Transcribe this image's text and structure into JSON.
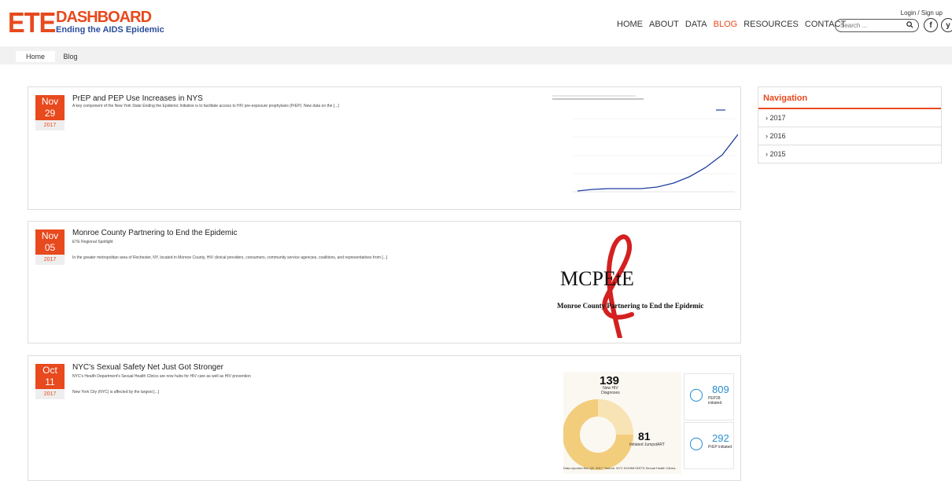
{
  "header": {
    "logo_ete": "ETE",
    "logo_dashboard": "DASHBOARD",
    "logo_subtitle": "Ending the AIDS Epidemic",
    "login_text": "Login / Sign up",
    "nav": [
      {
        "label": "HOME"
      },
      {
        "label": "ABOUT"
      },
      {
        "label": "DATA"
      },
      {
        "label": "BLOG",
        "active": true
      },
      {
        "label": "RESOURCES"
      },
      {
        "label": "CONTACT"
      }
    ],
    "search_placeholder": "Search ...",
    "search_icon": "search-icon",
    "social": [
      {
        "glyph": "f",
        "icon": "facebook-icon"
      },
      {
        "glyph": "y",
        "icon": "twitter-icon"
      }
    ]
  },
  "breadcrumb": {
    "home": "Home",
    "current": "Blog"
  },
  "posts": [
    {
      "month": "Nov",
      "day": "29",
      "year": "2017",
      "title": "PrEP and PEP Use Increases in NYS",
      "excerpt": "A key component of the New York State Ending the Epidemic Initiative is to facilitate access to HIV pre-exposure prophylaxis (PrEP). New data on the [...]"
    },
    {
      "month": "Nov",
      "day": "05",
      "year": "2017",
      "title": "Monroe County Partnering to End the Epidemic",
      "subtitle": "ETE Regional Spotlight",
      "excerpt": "In the greater metropolitan area of Rochester, NY, located in Monroe County, HIV clinical providers, consumers, community service agencies, coalitions, and representatives from [...]",
      "thumb_logo": "MCPEtE",
      "thumb_caption": "Monroe County Partnering to End the Epidemic"
    },
    {
      "month": "Oct",
      "day": "11",
      "year": "2017",
      "title": "NYC's Sexual Safety Net Just Got Stronger",
      "subtitle": "NYC's Health Department's Sexual Health Clinics are now hubs for HIV care as well as HIV prevention",
      "excerpt": "New York City (NYC) is affected by the largest [...]",
      "stats": {
        "diagnoses": "139",
        "diagnoses_label": "New HIV Diagnoses",
        "initiated": "81",
        "initiated_label": "Initiated JumpstART",
        "pep": "809",
        "pep_label": "PEP28 initiated",
        "prep": "292",
        "prep_label": "PrEP initiated",
        "footnote": "Data reported thru Q2, 2017. Source: NYC DOHMH BSTD Sexual Health Clinics"
      }
    }
  ],
  "sidebar": {
    "title": "Navigation",
    "items": [
      {
        "label": "› 2017"
      },
      {
        "label": "› 2016"
      },
      {
        "label": "› 2015"
      }
    ]
  },
  "colors": {
    "accent": "#e8491d",
    "brand_blue": "#2b4e9e",
    "line_blue": "#1f3f9e"
  }
}
